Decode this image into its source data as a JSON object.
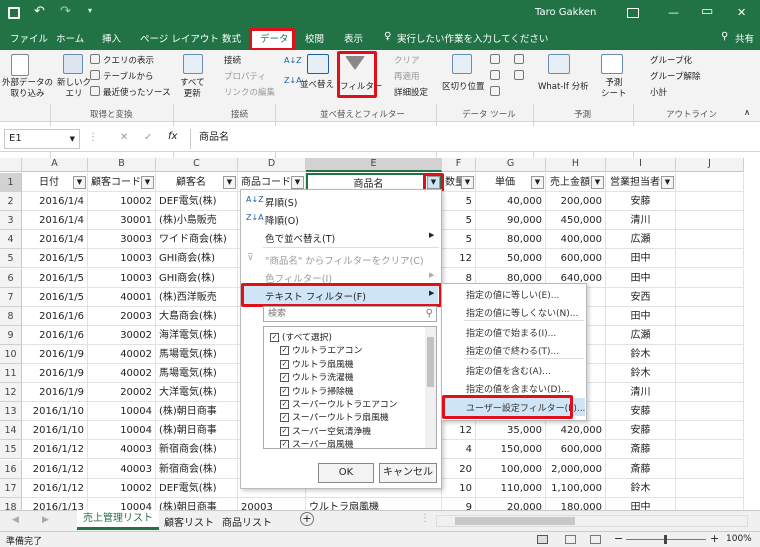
{
  "title": {
    "user": "Taro Gakken",
    "search_placeholder": "実行したい作業を入力してください",
    "share": "共有",
    "minimize": "—",
    "restore": "▭",
    "close": "✕"
  },
  "tabs": [
    "ファイル",
    "ホーム",
    "挿入",
    "ページ レイアウト",
    "数式",
    "データ",
    "校閲",
    "表示"
  ],
  "ribbon": {
    "external_data": "外部データの\n取り込み",
    "new_query": "新しいク\nエリ",
    "show_queries": "クエリの表示",
    "from_table": "テーブルから",
    "recent_sources": "最近使ったソース",
    "group_get": "取得と変換",
    "refresh_all": "すべて\n更新",
    "connections": "接続",
    "properties": "プロパティ",
    "edit_links": "リンクの編集",
    "group_conn": "接続",
    "sort": "並べ替え",
    "filter": "フィルター",
    "clear": "クリア",
    "reapply": "再適用",
    "advanced": "詳細設定",
    "group_sort": "並べ替えとフィルター",
    "text_to_columns": "区切り位置",
    "group_tools": "データ ツール",
    "whatif": "What-If 分析",
    "forecast_sheet": "予測\nシート",
    "group_forecast": "予測",
    "group_btn": "グループ化",
    "ungroup_btn": "グループ解除",
    "subtotal": "小計",
    "group_outline": "アウトライン"
  },
  "formula_bar": {
    "name_box": "E1",
    "fx": "fx",
    "content": "商品名"
  },
  "columns": [
    "A",
    "B",
    "C",
    "D",
    "E",
    "F",
    "G",
    "H",
    "I",
    "J"
  ],
  "rows": [
    [
      "日付",
      "顧客コード",
      "顧客名",
      "商品コード",
      "商品名",
      "数量",
      "単価",
      "売上金額",
      "営業担当者"
    ],
    [
      "2016/1/4",
      "10002",
      "DEF電気(株)",
      "",
      "",
      "5",
      "40,000",
      "200,000",
      "安藤"
    ],
    [
      "2016/1/4",
      "30001",
      "(株)小島販売",
      "",
      "",
      "5",
      "90,000",
      "450,000",
      "清川"
    ],
    [
      "2016/1/4",
      "30003",
      "ワイド商会(株)",
      "",
      "",
      "5",
      "80,000",
      "400,000",
      "広瀬"
    ],
    [
      "2016/1/5",
      "10003",
      "GHI商会(株)",
      "",
      "",
      "12",
      "50,000",
      "600,000",
      "田中"
    ],
    [
      "2016/1/5",
      "10003",
      "GHI商会(株)",
      "",
      "",
      "8",
      "80,000",
      "640,000",
      "田中"
    ],
    [
      "2016/1/5",
      "40001",
      "(株)西洋販売",
      "",
      "",
      "",
      "",
      "",
      "安西"
    ],
    [
      "2016/1/6",
      "20003",
      "大島商会(株)",
      "",
      "",
      "",
      "",
      "",
      "田中"
    ],
    [
      "2016/1/6",
      "30002",
      "海洋電気(株)",
      "",
      "",
      "",
      "",
      "",
      "広瀬"
    ],
    [
      "2016/1/9",
      "40002",
      "馬場電気(株)",
      "",
      "",
      "",
      "",
      "",
      "鈴木"
    ],
    [
      "2016/1/9",
      "40002",
      "馬場電気(株)",
      "",
      "",
      "",
      "",
      "",
      "鈴木"
    ],
    [
      "2016/1/9",
      "20002",
      "大洋電気(株)",
      "",
      "",
      "",
      "",
      "",
      "清川"
    ],
    [
      "2016/1/10",
      "10004",
      "(株)朝日商事",
      "",
      "",
      "",
      "",
      "",
      "安藤"
    ],
    [
      "2016/1/10",
      "10004",
      "(株)朝日商事",
      "",
      "",
      "12",
      "35,000",
      "420,000",
      "安藤"
    ],
    [
      "2016/1/12",
      "40003",
      "新宿商会(株)",
      "",
      "",
      "4",
      "150,000",
      "600,000",
      "斎藤"
    ],
    [
      "2016/1/12",
      "40003",
      "新宿商会(株)",
      "",
      "",
      "20",
      "100,000",
      "2,000,000",
      "斎藤"
    ],
    [
      "2016/1/12",
      "10002",
      "DEF電気(株)",
      "",
      "",
      "10",
      "110,000",
      "1,100,000",
      "鈴木"
    ],
    [
      "2016/1/13",
      "10004",
      "(株)朝日商事",
      "20003",
      "ウルトラ扇風機",
      "9",
      "20,000",
      "180,000",
      "田中"
    ]
  ],
  "menu": {
    "sort_asc": "昇順(S)",
    "sort_desc": "降順(O)",
    "sort_color": "色で並べ替え(T)",
    "clear_filter": "\"商品名\" からフィルターをクリア(C)",
    "color_filter": "色フィルター(I)",
    "text_filter": "テキスト フィルター(F)",
    "search_placeholder": "検索",
    "items": [
      "(すべて選択)",
      "ウルトラエアコン",
      "ウルトラ扇風機",
      "ウルトラ洗濯機",
      "ウルトラ掃除機",
      "スーパーウルトラエアコン",
      "スーパーウルトラ扇風機",
      "スーパー空気清浄機",
      "スーパー扇風機"
    ],
    "ok": "OK",
    "cancel": "キャンセル"
  },
  "submenu": [
    "指定の値に等しい(E)...",
    "指定の値に等しくない(N)...",
    "指定の値で始まる(I)...",
    "指定の値で終わる(T)...",
    "指定の値を含む(A)...",
    "指定の値を含まない(D)...",
    "ユーザー設定フィルター(F)..."
  ],
  "sheets": [
    "売上管理リスト",
    "顧客リスト",
    "商品リスト"
  ],
  "status": {
    "ready": "準備完了",
    "zoom": "100%"
  },
  "colors": {
    "excel_green": "#217346",
    "highlight_red": "#e0101a"
  }
}
